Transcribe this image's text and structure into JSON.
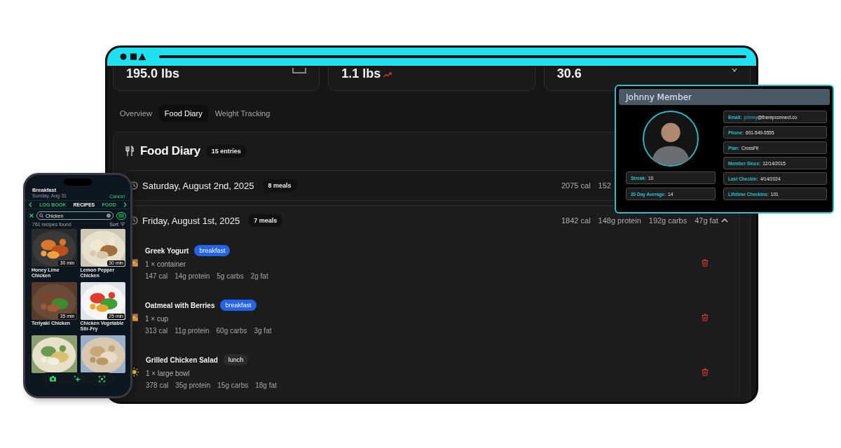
{
  "browser": {
    "stats": [
      {
        "value": "195.0 lbs"
      },
      {
        "value": "1.1 lbs"
      },
      {
        "value": "30.6"
      }
    ],
    "tabs": [
      {
        "label": "Overview",
        "selected": false
      },
      {
        "label": "Food Diary",
        "selected": true
      },
      {
        "label": "Weight Tracking",
        "selected": false
      }
    ],
    "food_diary": {
      "title": "Food Diary",
      "count": "15 entries",
      "days": [
        {
          "date": "Saturday, August 2nd, 2025",
          "meals_count": "8 meals",
          "expanded": false,
          "totals": [
            "2075 cal",
            "152"
          ]
        },
        {
          "date": "Friday, August 1st, 2025",
          "meals_count": "7 meals",
          "expanded": true,
          "totals": [
            "1842 cal",
            "148g protein",
            "192g carbs",
            "47g fat"
          ],
          "meals": [
            {
              "name": "Greek Yogurt",
              "tag": {
                "label": "breakfast",
                "color": "#2563eb"
              },
              "serving": "1 × container",
              "nutrients": [
                "147 cal",
                "14g protein",
                "5g carbs",
                "2g fat"
              ]
            },
            {
              "name": "Oatmeal with Berries",
              "tag": {
                "label": "breakfast",
                "color": "#2563eb"
              },
              "serving": "1 × cup",
              "nutrients": [
                "313 cal",
                "11g protein",
                "60g carbs",
                "3g fat"
              ]
            },
            {
              "kind": "sun",
              "name": "Grilled Chicken Salad",
              "tag": {
                "label": "lunch",
                "color": "#2b2b2b"
              },
              "serving": "1 × large bowl",
              "nutrients": [
                "378 cal",
                "35g protein",
                "15g carbs",
                "18g fat"
              ]
            }
          ]
        }
      ]
    }
  },
  "phone": {
    "header": {
      "title": "Breakfast",
      "date": "Sunday, Aug 31",
      "action": "Cancel"
    },
    "tabs": [
      {
        "label": "LOG BOOK",
        "selected": false
      },
      {
        "label": "RECIPES",
        "selected": true
      },
      {
        "label": "FOOD",
        "selected": false
      }
    ],
    "search": {
      "value": "Chicken"
    },
    "results": "761 recipes found",
    "sort": "Sort",
    "recipes": [
      {
        "kind": "recipe",
        "name": "Honey Lime Chicken",
        "time": "30 min"
      },
      {
        "kind": "recipe",
        "name": "Lemon Pepper Chicken",
        "time": "30 min"
      },
      {
        "kind": "recipe",
        "name": "Teriyaki Chicken",
        "time": "35 min"
      },
      {
        "kind": "recipe",
        "name": "Chicken Vegetable Stir-Fry",
        "time": "25 min"
      },
      {
        "kind": "picture"
      },
      {
        "kind": "picture"
      }
    ]
  },
  "profile": {
    "name": "Johnny Member",
    "stats": [
      {
        "label": "Streak:",
        "value": "10"
      },
      {
        "label": "30 Day Average:",
        "value": "14"
      }
    ],
    "details": [
      {
        "label": "Email:",
        "link": "johnny",
        "value": "@therepconnect.co"
      },
      {
        "label": "Phone:",
        "value": "601-549-5555"
      },
      {
        "label": "Plan:",
        "value": "CrossFit"
      },
      {
        "label": "Member Since:",
        "value": "12/14/2015"
      },
      {
        "label": "Last Checkin:",
        "value": "4/14/2024"
      },
      {
        "label": "Lifetime Checkins:",
        "value": "101"
      }
    ]
  }
}
